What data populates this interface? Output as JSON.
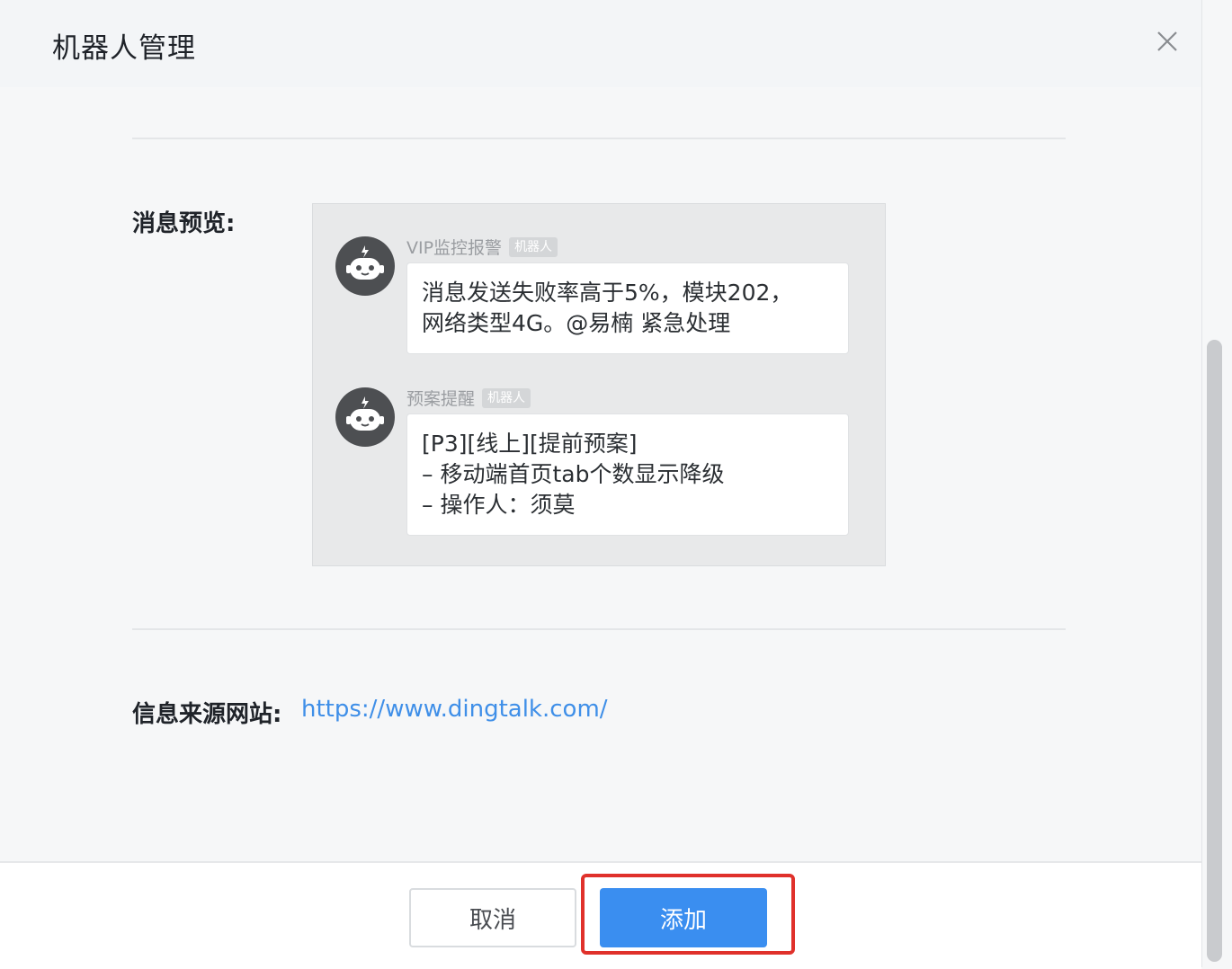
{
  "dialog": {
    "title": "机器人管理",
    "close_icon": "close-icon"
  },
  "preview": {
    "label": "消息预览:",
    "messages": [
      {
        "sender": "VIP监控报警",
        "tag": "机器人",
        "lines": [
          "消息发送失败率高于5%，模块202，",
          "网络类型4G。@易楠 紧急处理"
        ]
      },
      {
        "sender": "预案提醒",
        "tag": "机器人",
        "lines": [
          "[P3][线上][提前预案]",
          "– 移动端首页tab个数显示降级",
          "– 操作人：须莫"
        ]
      }
    ]
  },
  "source": {
    "label": "信息来源网站:",
    "url": "https://www.dingtalk.com/"
  },
  "footer": {
    "cancel_label": "取消",
    "add_label": "添加"
  },
  "colors": {
    "accent": "#3a8ef0",
    "link": "#3f8fe8",
    "highlight": "#e0312b"
  }
}
